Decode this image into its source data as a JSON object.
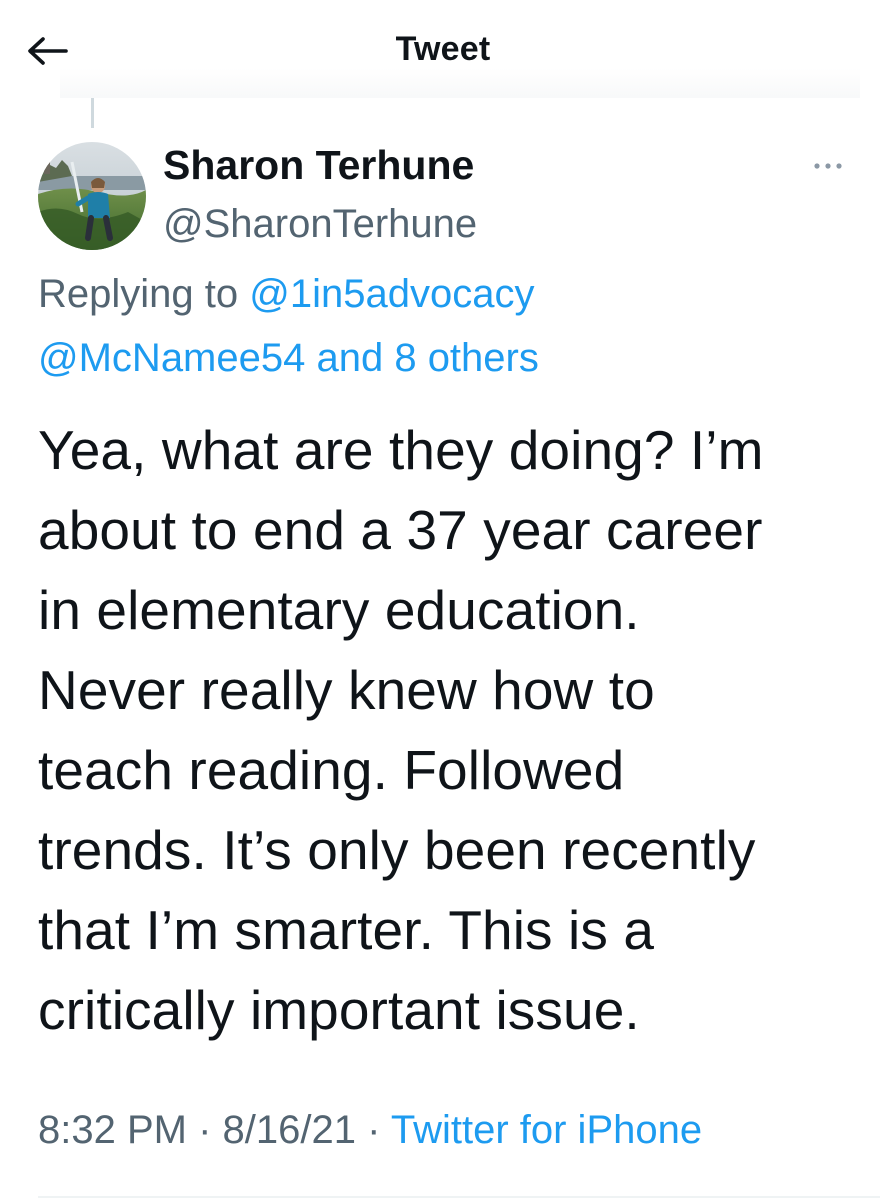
{
  "header": {
    "title": "Tweet",
    "back_icon": "arrow-left-icon"
  },
  "tweet": {
    "author": {
      "display_name": "Sharon Terhune",
      "handle": "@SharonTerhune",
      "avatar_icon": "profile-photo"
    },
    "more_icon": "more-dots-icon",
    "reply_context": {
      "prefix": "Replying to",
      "mention_1": "@1in5advocacy",
      "mention_2": "@McNamee54 and 8 others"
    },
    "text_lines": [
      "Yea, what are they doing? I’m",
      "about to end a 37 year career",
      "in elementary education.",
      "Never really knew how to",
      "teach reading. Followed",
      "trends. It’s only been recently",
      "that I’m smarter. This is a",
      "critically important issue."
    ],
    "meta": {
      "time": "8:32 PM",
      "separator": "·",
      "date": "8/16/21",
      "source": "Twitter for iPhone"
    }
  },
  "colors": {
    "text": "#0f1419",
    "muted": "#536471",
    "link": "#1d9bf0"
  }
}
